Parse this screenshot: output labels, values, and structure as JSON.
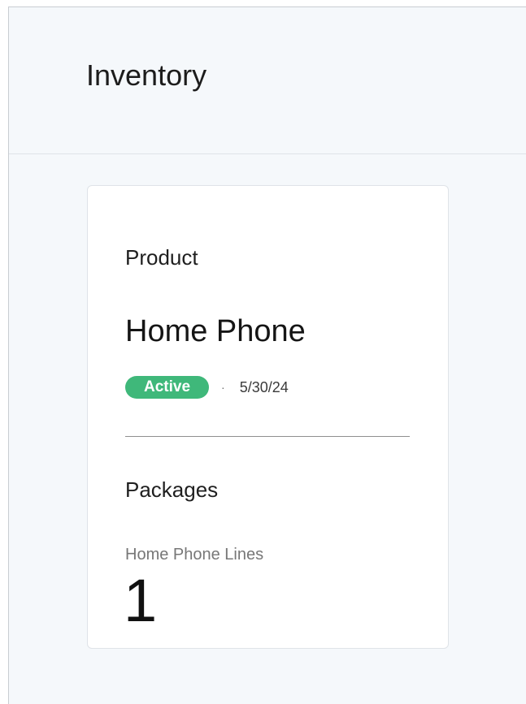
{
  "header": {
    "title": "Inventory"
  },
  "card": {
    "product_label": "Product",
    "product_name": "Home Phone",
    "status": {
      "label": "Active",
      "color": "#3fb87a",
      "separator": "·",
      "date": "5/30/24"
    },
    "packages_label": "Packages",
    "package_metric": {
      "label": "Home Phone Lines",
      "value": "1"
    }
  }
}
